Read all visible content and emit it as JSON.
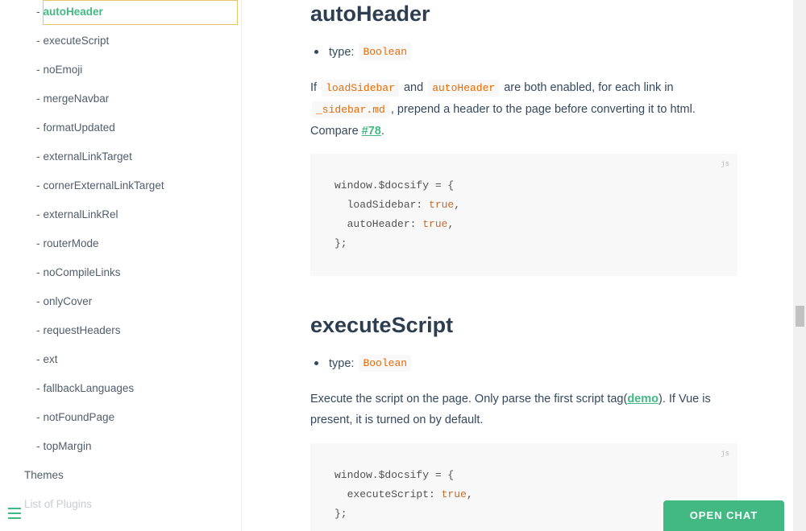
{
  "sidebar": {
    "sub_items": [
      {
        "label": "autoHeader"
      },
      {
        "label": "executeScript"
      },
      {
        "label": "noEmoji"
      },
      {
        "label": "mergeNavbar"
      },
      {
        "label": "formatUpdated"
      },
      {
        "label": "externalLinkTarget"
      },
      {
        "label": "cornerExternalLinkTarget"
      },
      {
        "label": "externalLinkRel"
      },
      {
        "label": "routerMode"
      },
      {
        "label": "noCompileLinks"
      },
      {
        "label": "onlyCover"
      },
      {
        "label": "requestHeaders"
      },
      {
        "label": "ext"
      },
      {
        "label": "fallbackLanguages"
      },
      {
        "label": "notFoundPage"
      },
      {
        "label": "topMargin"
      }
    ],
    "dash": "-",
    "themes": "Themes",
    "plugins": "List of Plugins"
  },
  "section1": {
    "title": "autoHeader",
    "type_label": "type:",
    "type_value": "Boolean",
    "p_if": "If",
    "p_code1": "loadSidebar",
    "p_and": "and",
    "p_code2": "autoHeader",
    "p_rest1": "are both enabled, for each link in",
    "p_code3": "_sidebar.md",
    "p_rest2": ", prepend a header to the page before converting it to html.",
    "p_compare": "Compare",
    "p_link": "#78",
    "p_period": ".",
    "lang": "js",
    "code": {
      "l1": "window.$docsify = {",
      "l2_key": "  loadSidebar: ",
      "l2_val": "true",
      "l2_end": ",",
      "l3_key": "  autoHeader: ",
      "l3_val": "true",
      "l3_end": ",",
      "l4": "};"
    }
  },
  "section2": {
    "title": "executeScript",
    "type_label": "type:",
    "type_value": "Boolean",
    "p_text1": "Execute the script on the page. Only parse the first script tag(",
    "p_link": "demo",
    "p_text2": "). If Vue is present, it is turned on by default.",
    "lang": "js",
    "code": {
      "l1": "window.$docsify = {",
      "l2_key": "  executeScript: ",
      "l2_val": "true",
      "l2_end": ",",
      "l3": "};"
    }
  },
  "chat": {
    "label": "OPEN CHAT"
  },
  "colors": {
    "accent": "#42b983",
    "code": "#e96900"
  }
}
